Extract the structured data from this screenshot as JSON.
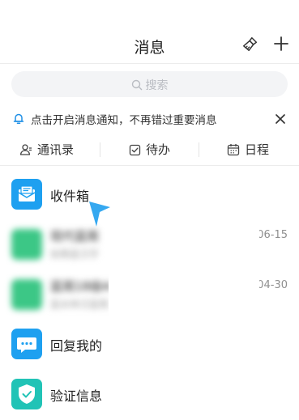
{
  "header": {
    "title": "消息"
  },
  "search": {
    "placeholder": "搜索"
  },
  "notice": {
    "text": "点击开启消息通知，不再错过重要消息"
  },
  "tabs": [
    {
      "label": "通讯录",
      "icon": "contacts-icon"
    },
    {
      "label": "待办",
      "icon": "todo-icon"
    },
    {
      "label": "日程",
      "icon": "calendar-icon"
    }
  ],
  "messages": {
    "inbox": {
      "label": "收件箱",
      "color": "#1ea0f0"
    },
    "blurred1": {
      "name": "现代蓝周",
      "sub": "如南蓝汉字",
      "date": "06-15",
      "color": "#3cc786"
    },
    "blurred2": {
      "name": "蓝周18级4-6",
      "sub": "蓝水林汉蓝周",
      "date": "04-30",
      "color": "#3cc786"
    },
    "replies": {
      "label": "回复我的",
      "color": "#1ea0f0"
    },
    "verify": {
      "label": "验证信息",
      "color": "#21c3b6"
    }
  }
}
